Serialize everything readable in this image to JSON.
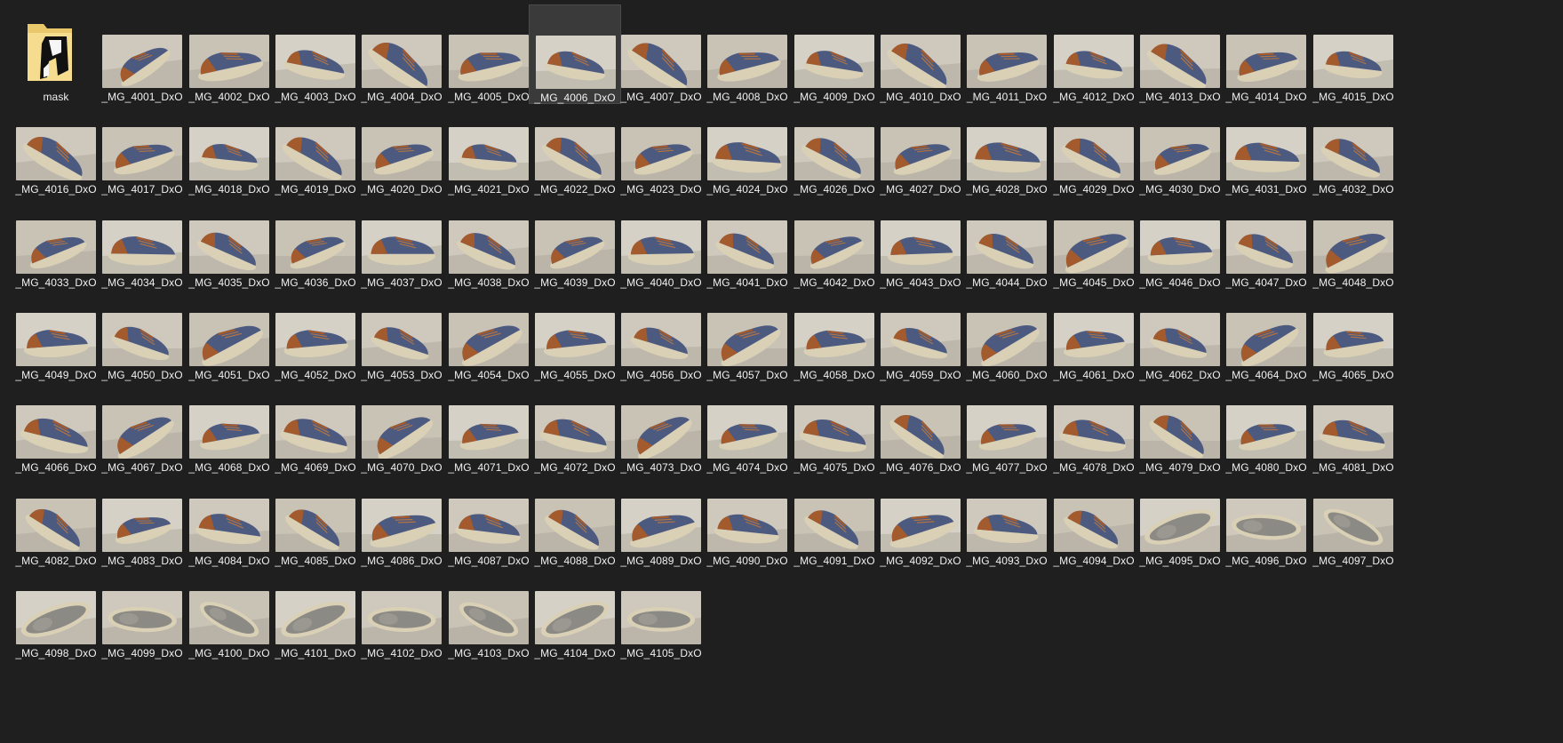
{
  "folder": {
    "name": "mask",
    "icon": "folder-icon"
  },
  "selected_file": "_MG_4006_DxO",
  "colors": {
    "background": "#1f1f1f",
    "selection": "#3a3a3a",
    "label_text": "#f0f0f0",
    "shoe_upper": "#4d5a80",
    "shoe_leather": "#a35a2c",
    "shoe_sole": "#d9d0b6"
  },
  "files": [
    "_MG_4001_DxO",
    "_MG_4002_DxO",
    "_MG_4003_DxO",
    "_MG_4004_DxO",
    "_MG_4005_DxO",
    "_MG_4006_DxO",
    "_MG_4007_DxO",
    "_MG_4008_DxO",
    "_MG_4009_DxO",
    "_MG_4010_DxO",
    "_MG_4011_DxO",
    "_MG_4012_DxO",
    "_MG_4013_DxO",
    "_MG_4014_DxO",
    "_MG_4015_DxO",
    "_MG_4016_DxO",
    "_MG_4017_DxO",
    "_MG_4018_DxO",
    "_MG_4019_DxO",
    "_MG_4020_DxO",
    "_MG_4021_DxO",
    "_MG_4022_DxO",
    "_MG_4023_DxO",
    "_MG_4024_DxO",
    "_MG_4026_DxO",
    "_MG_4027_DxO",
    "_MG_4028_DxO",
    "_MG_4029_DxO",
    "_MG_4030_DxO",
    "_MG_4031_DxO",
    "_MG_4032_DxO",
    "_MG_4033_DxO",
    "_MG_4034_DxO",
    "_MG_4035_DxO",
    "_MG_4036_DxO",
    "_MG_4037_DxO",
    "_MG_4038_DxO",
    "_MG_4039_DxO",
    "_MG_4040_DxO",
    "_MG_4041_DxO",
    "_MG_4042_DxO",
    "_MG_4043_DxO",
    "_MG_4044_DxO",
    "_MG_4045_DxO",
    "_MG_4046_DxO",
    "_MG_4047_DxO",
    "_MG_4048_DxO",
    "_MG_4049_DxO",
    "_MG_4050_DxO",
    "_MG_4051_DxO",
    "_MG_4052_DxO",
    "_MG_4053_DxO",
    "_MG_4054_DxO",
    "_MG_4055_DxO",
    "_MG_4056_DxO",
    "_MG_4057_DxO",
    "_MG_4058_DxO",
    "_MG_4059_DxO",
    "_MG_4060_DxO",
    "_MG_4061_DxO",
    "_MG_4062_DxO",
    "_MG_4064_DxO",
    "_MG_4065_DxO",
    "_MG_4066_DxO",
    "_MG_4067_DxO",
    "_MG_4068_DxO",
    "_MG_4069_DxO",
    "_MG_4070_DxO",
    "_MG_4071_DxO",
    "_MG_4072_DxO",
    "_MG_4073_DxO",
    "_MG_4074_DxO",
    "_MG_4075_DxO",
    "_MG_4076_DxO",
    "_MG_4077_DxO",
    "_MG_4078_DxO",
    "_MG_4079_DxO",
    "_MG_4080_DxO",
    "_MG_4081_DxO",
    "_MG_4082_DxO",
    "_MG_4083_DxO",
    "_MG_4084_DxO",
    "_MG_4085_DxO",
    "_MG_4086_DxO",
    "_MG_4087_DxO",
    "_MG_4088_DxO",
    "_MG_4089_DxO",
    "_MG_4090_DxO",
    "_MG_4091_DxO",
    "_MG_4092_DxO",
    "_MG_4093_DxO",
    "_MG_4094_DxO",
    "_MG_4095_DxO",
    "_MG_4096_DxO",
    "_MG_4097_DxO",
    "_MG_4098_DxO",
    "_MG_4099_DxO",
    "_MG_4100_DxO",
    "_MG_4101_DxO",
    "_MG_4102_DxO",
    "_MG_4103_DxO",
    "_MG_4104_DxO",
    "_MG_4105_DxO"
  ]
}
